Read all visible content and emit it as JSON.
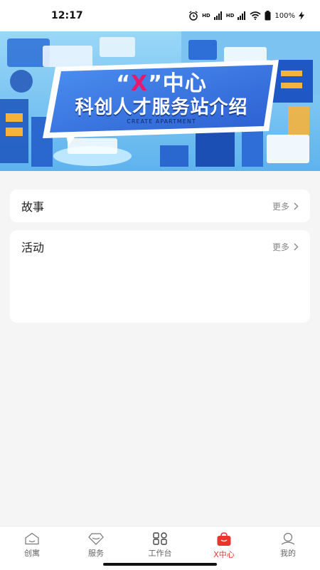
{
  "status_bar": {
    "time": "12:17",
    "battery": "100%",
    "signal_label_1": "HD",
    "signal_label_2": "HD"
  },
  "banner": {
    "title_quote_open": "“",
    "title_x": "X",
    "title_quote_close": "”",
    "title_center": "中心",
    "subtitle": "科创人才服务站介绍",
    "tagline": "CREATE APARTMENT"
  },
  "sections": [
    {
      "title": "故事",
      "more_label": "更多"
    },
    {
      "title": "活动",
      "more_label": "更多"
    }
  ],
  "tab_bar": {
    "items": [
      {
        "label": "创寓",
        "icon": "home-icon",
        "active": false
      },
      {
        "label": "服务",
        "icon": "diamond-icon",
        "active": false
      },
      {
        "label": "工作台",
        "icon": "workbench-icon",
        "active": false
      },
      {
        "label": "X中心",
        "icon": "bag-icon",
        "active": true
      },
      {
        "label": "我的",
        "icon": "profile-icon",
        "active": false
      }
    ]
  },
  "colors": {
    "accent": "#e8362f",
    "background": "#f5f5f5",
    "banner_blue": "#3f7fe0",
    "banner_pink": "#e6196e"
  }
}
